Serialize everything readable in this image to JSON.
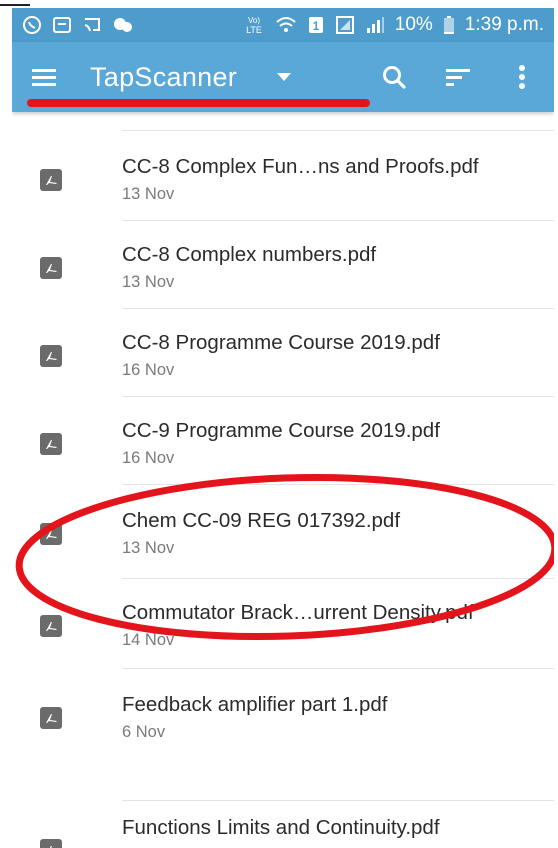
{
  "status_bar": {
    "icons": [
      "whatsapp-icon",
      "gallery-icon",
      "cast-icon",
      "chat-bubbles-icon",
      "volte-icon",
      "wifi-icon",
      "sim-icon",
      "signal-alt-icon",
      "signal-icon"
    ],
    "volte_label": "Vo)\nLTE",
    "sim_label": "1",
    "battery_text": "10%",
    "time": "1:39 p.m."
  },
  "app_bar": {
    "title": "TapScanner",
    "icons": [
      "menu-icon",
      "dropdown-icon",
      "search-icon",
      "sort-icon",
      "more-vert-icon"
    ],
    "background": "#59a8d8"
  },
  "files": [
    {
      "name": "CC-8 Complex Fun…ns and Proofs.pdf",
      "date": "13 Nov"
    },
    {
      "name": "CC-8 Complex numbers.pdf",
      "date": "13 Nov"
    },
    {
      "name": "CC-8 Programme Course 2019.pdf",
      "date": "16 Nov"
    },
    {
      "name": "CC-9 Programme Course 2019.pdf",
      "date": "16 Nov"
    },
    {
      "name": "Chem CC-09 REG 017392.pdf",
      "date": "13 Nov"
    },
    {
      "name": "Commutator Brack…urrent Density.pdf",
      "date": "14 Nov"
    },
    {
      "name": "Feedback amplifier part 1.pdf",
      "date": "6 Nov"
    },
    {
      "name": "Functions Limits and Continuity.pdf",
      "date": ""
    }
  ],
  "annotation_color": "#e3141b"
}
